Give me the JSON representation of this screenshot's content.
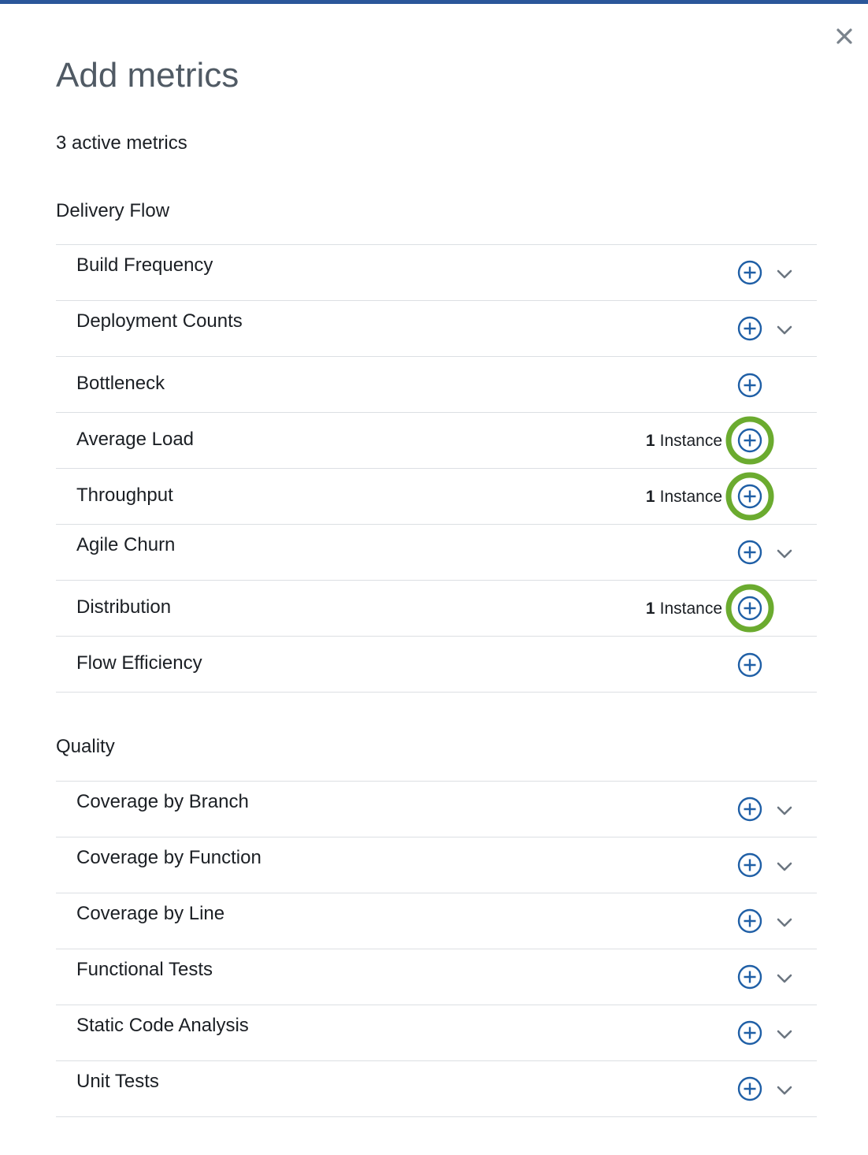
{
  "dialog": {
    "title": "Add metrics",
    "active_count_text": "3 active metrics"
  },
  "colors": {
    "top_bar": "#2b579a",
    "add_icon": "#1f5fa6",
    "active_ring": "#6bab2f",
    "chevron": "#6b7580",
    "close": "#7a838c"
  },
  "icons": {
    "close": "close-icon",
    "add": "plus-circle-icon",
    "expand": "chevron-down-icon"
  },
  "sections": [
    {
      "title": "Delivery Flow",
      "metrics": [
        {
          "label": "Build Frequency",
          "instances": "",
          "expandable": true
        },
        {
          "label": "Deployment Counts",
          "instances": "",
          "expandable": true
        },
        {
          "label": "Bottleneck",
          "instances": "",
          "expandable": false
        },
        {
          "label": "Average Load",
          "instance_count": "1",
          "instance_word": "Instance",
          "expandable": false
        },
        {
          "label": "Throughput",
          "instance_count": "1",
          "instance_word": "Instance",
          "expandable": false
        },
        {
          "label": "Agile Churn",
          "instances": "",
          "expandable": true
        },
        {
          "label": "Distribution",
          "instance_count": "1",
          "instance_word": "Instance",
          "expandable": false
        },
        {
          "label": "Flow Efficiency",
          "instances": "",
          "expandable": false
        }
      ]
    },
    {
      "title": "Quality",
      "metrics": [
        {
          "label": "Coverage by Branch",
          "expandable": true
        },
        {
          "label": "Coverage by Function",
          "expandable": true
        },
        {
          "label": "Coverage by Line",
          "expandable": true
        },
        {
          "label": "Functional Tests",
          "expandable": true
        },
        {
          "label": "Static Code Analysis",
          "expandable": true
        },
        {
          "label": "Unit Tests",
          "expandable": true
        }
      ]
    }
  ]
}
